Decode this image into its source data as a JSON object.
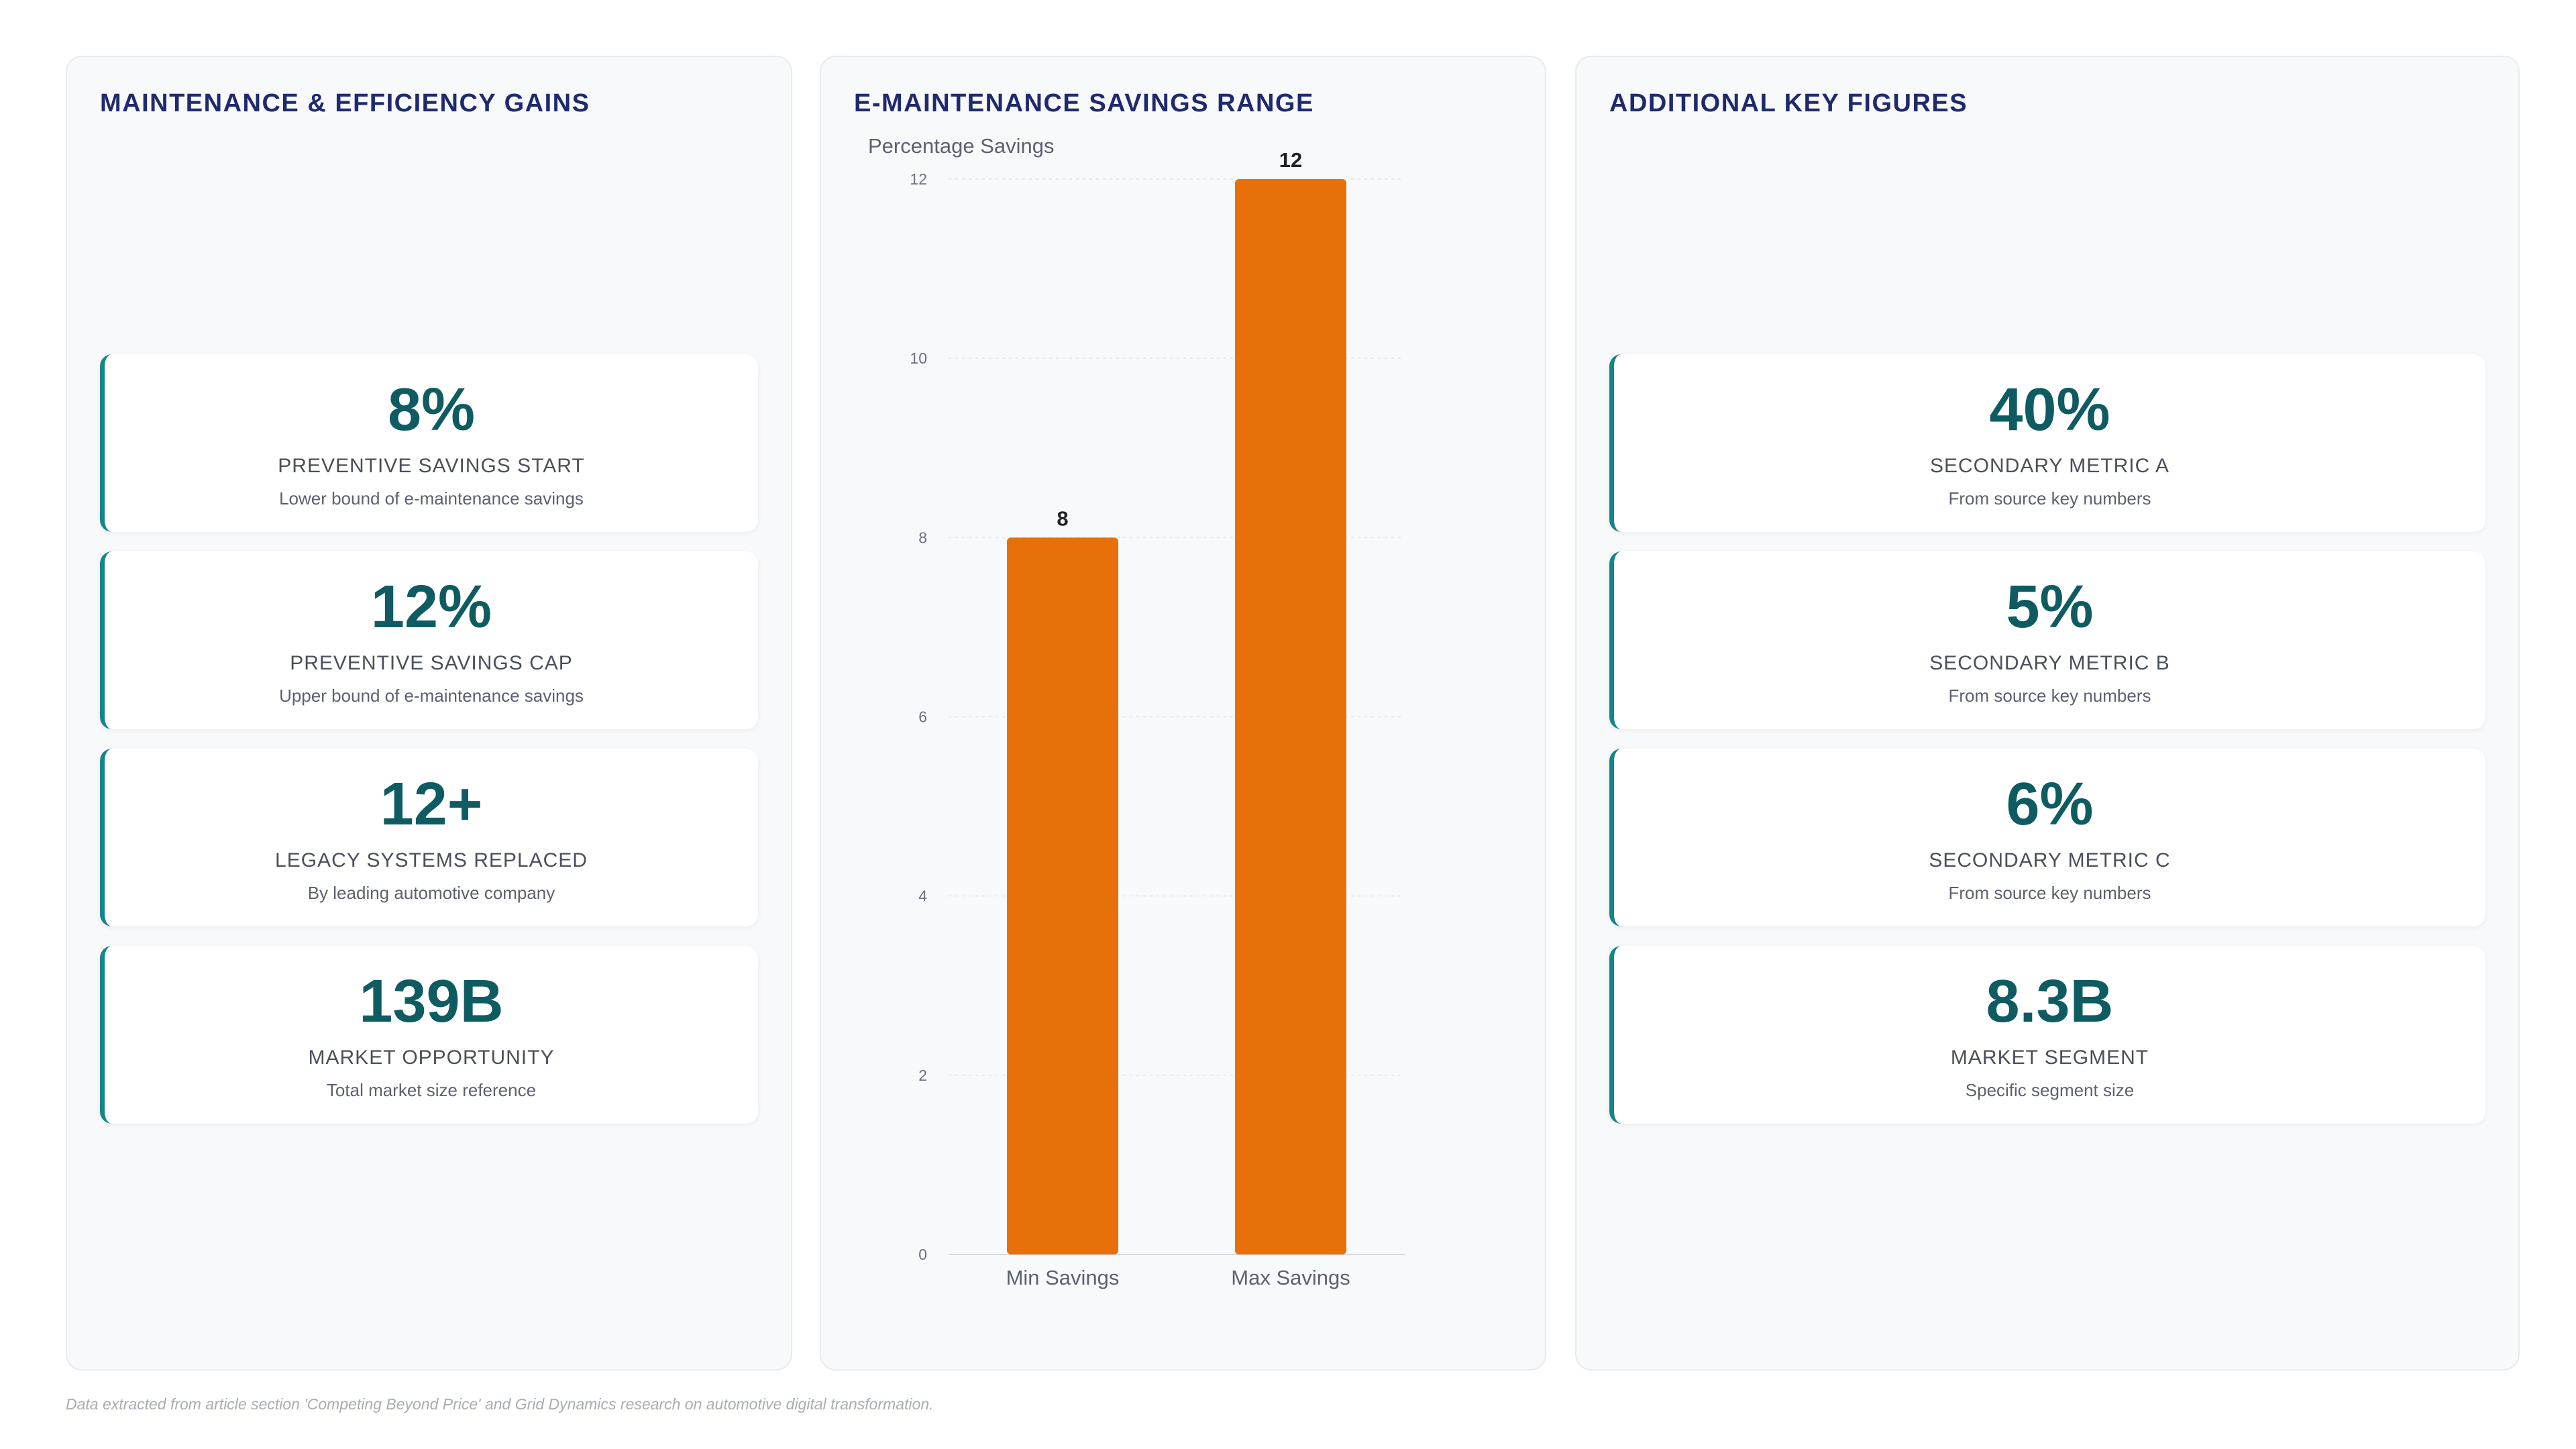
{
  "left_panel": {
    "title": "MAINTENANCE & EFFICIENCY GAINS",
    "cards": [
      {
        "value": "8%",
        "label": "PREVENTIVE SAVINGS START",
        "desc": "Lower bound of e-maintenance savings"
      },
      {
        "value": "12%",
        "label": "PREVENTIVE SAVINGS CAP",
        "desc": "Upper bound of e-maintenance savings"
      },
      {
        "value": "12+",
        "label": "LEGACY SYSTEMS REPLACED",
        "desc": "By leading automotive company"
      },
      {
        "value": "139B",
        "label": "MARKET OPPORTUNITY",
        "desc": "Total market size reference"
      }
    ]
  },
  "middle_panel": {
    "title": "E-MAINTENANCE SAVINGS RANGE"
  },
  "right_panel": {
    "title": "ADDITIONAL KEY FIGURES",
    "cards": [
      {
        "value": "40%",
        "label": "SECONDARY METRIC A",
        "desc": "From source key numbers"
      },
      {
        "value": "5%",
        "label": "SECONDARY METRIC B",
        "desc": "From source key numbers"
      },
      {
        "value": "6%",
        "label": "SECONDARY METRIC C",
        "desc": "From source key numbers"
      },
      {
        "value": "8.3B",
        "label": "MARKET SEGMENT",
        "desc": "Specific segment size"
      }
    ]
  },
  "chart_data": {
    "type": "bar",
    "title": "E-MAINTENANCE SAVINGS RANGE",
    "ylabel": "Percentage Savings",
    "categories": [
      "Min Savings",
      "Max Savings"
    ],
    "values": [
      8,
      12
    ],
    "ylim": [
      0,
      12
    ],
    "yticks": [
      0,
      2,
      4,
      6,
      8,
      10,
      12
    ],
    "grid": true,
    "bar_color": "#e8700a"
  },
  "footnote": "Data extracted from article section 'Competing Beyond Price' and Grid Dynamics research on automotive digital transformation."
}
